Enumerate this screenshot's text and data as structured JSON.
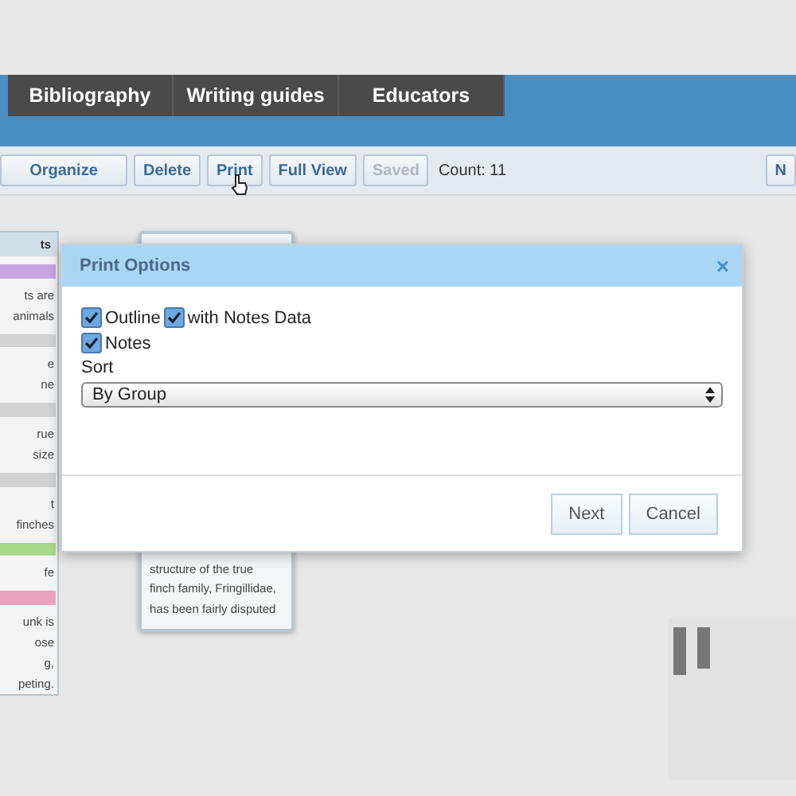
{
  "nav": {
    "tabs": [
      {
        "label": "Bibliography"
      },
      {
        "label": "Writing guides"
      },
      {
        "label": "Educators"
      }
    ]
  },
  "toolbar": {
    "buttons": [
      {
        "label": "Organize",
        "disabled": false
      },
      {
        "label": "Delete",
        "disabled": false
      },
      {
        "label": "Print",
        "disabled": false
      },
      {
        "label": "Full View",
        "disabled": false
      },
      {
        "label": "Saved",
        "disabled": true
      }
    ],
    "count": "Count: 11",
    "right_button": "N"
  },
  "left_panel": {
    "header": "ts",
    "groups": [
      {
        "color": "#c8a6e2",
        "lines": [
          "ts are",
          "animals"
        ]
      },
      {
        "color": "#d2d2d2",
        "lines": [
          "e",
          "ne"
        ]
      },
      {
        "color": "#d2d2d2",
        "lines": [
          "rue",
          "size"
        ]
      },
      {
        "color": "#d2d2d2",
        "lines": [
          "t",
          "finches"
        ]
      },
      {
        "color": "#a9da8c",
        "lines": [
          "fe"
        ]
      },
      {
        "color": "#e8a2bb",
        "lines": [
          "unk is",
          "ose",
          "g,",
          "peting."
        ]
      }
    ]
  },
  "card": {
    "lines": [
      "structure of the true",
      "finch family, Fringillidae,",
      "has been fairly disputed"
    ]
  },
  "dialog": {
    "title": "Print Options",
    "close": "×",
    "option_rows": [
      [
        {
          "label": "Outline",
          "checked": true
        },
        {
          "label": "with Notes Data",
          "checked": true
        }
      ],
      [
        {
          "label": "Notes",
          "checked": true
        }
      ]
    ],
    "sort_label": "Sort",
    "sort_value": "By Group",
    "buttons": [
      "Next",
      "Cancel"
    ]
  }
}
